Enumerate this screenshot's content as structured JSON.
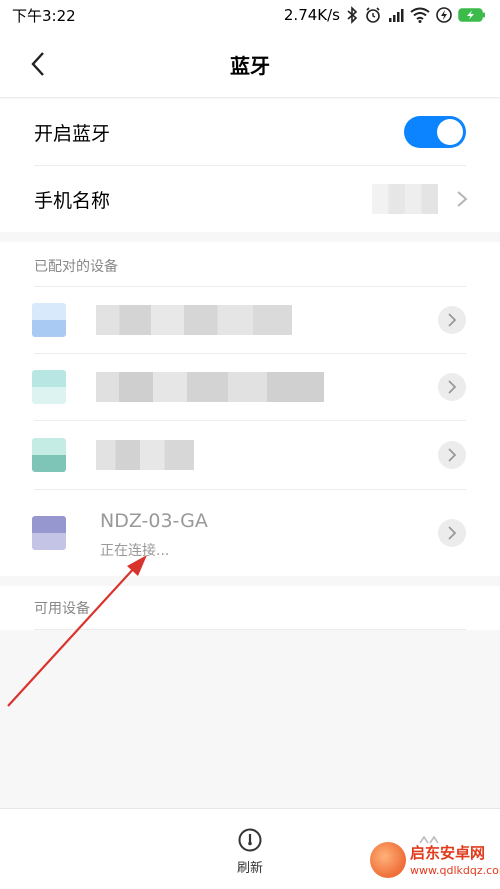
{
  "status_bar": {
    "time": "下午3:22",
    "speed": "2.74K/s",
    "icons": [
      "bluetooth-icon",
      "alarm-icon",
      "signal-icon",
      "wifi-icon",
      "charging-icon",
      "battery-icon"
    ]
  },
  "header": {
    "title": "蓝牙"
  },
  "settings": {
    "bluetooth_label": "开启蓝牙",
    "bluetooth_enabled": true,
    "device_name_label": "手机名称"
  },
  "paired": {
    "title": "已配对的设备",
    "devices": [
      {
        "icon_color": "#bcd9f7"
      },
      {
        "icon_color": "#c8eae7"
      },
      {
        "icon_color": "#8fcfc3"
      },
      {
        "icon_color": "#a7a7d6",
        "name": "NDZ-03-GA",
        "status": "正在连接..."
      }
    ]
  },
  "available": {
    "title": "可用设备"
  },
  "bottom_bar": {
    "refresh_label": "刷新"
  },
  "watermark": {
    "title": "启东安卓网",
    "url": "www.qdlkdqz.com"
  },
  "colors": {
    "accent": "#0d84ff",
    "annotation_arrow": "#d9342b"
  }
}
